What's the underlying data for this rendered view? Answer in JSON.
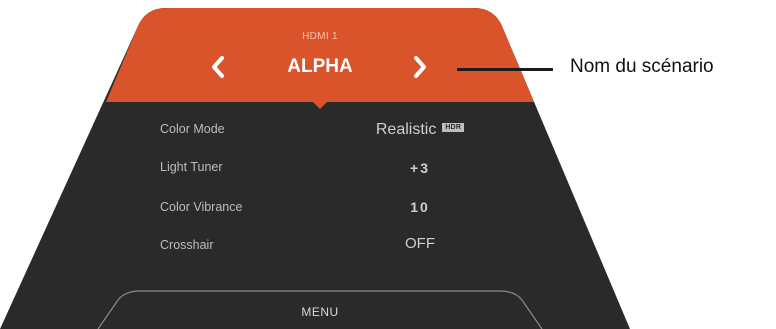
{
  "osd": {
    "input_source": "HDMI 1",
    "scenario_name": "ALPHA",
    "prev_icon": "chevron-left-icon",
    "next_icon": "chevron-right-icon",
    "rows": [
      {
        "label": "Color Mode",
        "value": "Realistic",
        "badge": "HDR"
      },
      {
        "label": "Light Tuner",
        "value": "+3"
      },
      {
        "label": "Color Vibrance",
        "value": "10"
      },
      {
        "label": "Crosshair",
        "value": "OFF"
      }
    ],
    "menu_label": "MENU"
  },
  "callout": {
    "text": "Nom du scénario"
  },
  "colors": {
    "header_orange": "#d9542b",
    "panel_dark": "#2a2a2a",
    "text_light": "#bdbdbd"
  }
}
